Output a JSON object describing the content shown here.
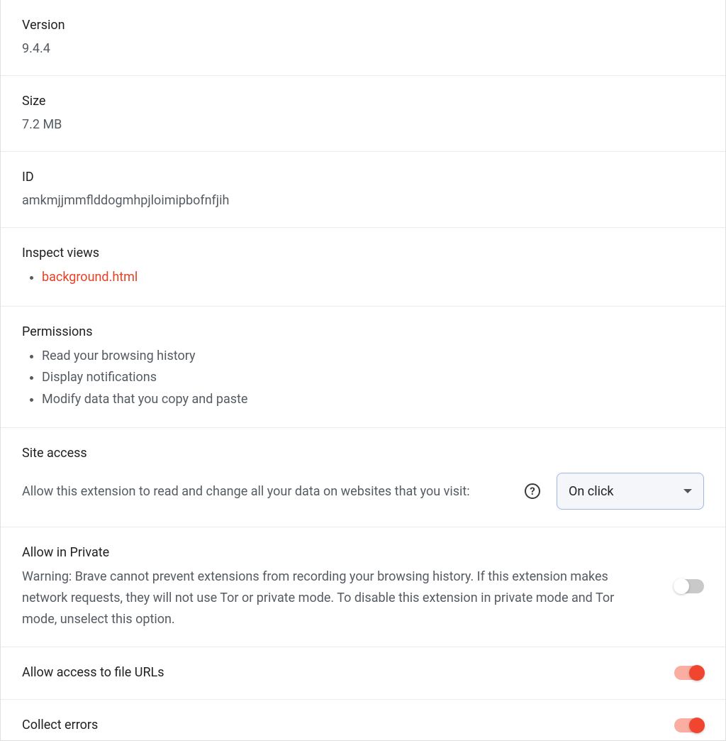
{
  "sections": {
    "version": {
      "label": "Version",
      "value": "9.4.4"
    },
    "size": {
      "label": "Size",
      "value": "7.2 MB"
    },
    "id": {
      "label": "ID",
      "value": "amkmjjmmflddogmhpjloimipbofnfjih"
    },
    "inspect": {
      "label": "Inspect views",
      "links": [
        "background.html"
      ]
    },
    "permissions": {
      "label": "Permissions",
      "items": [
        "Read your browsing history",
        "Display notifications",
        "Modify data that you copy and paste"
      ]
    },
    "site_access": {
      "label": "Site access",
      "desc": "Allow this extension to read and change all your data on websites that you visit:",
      "help": "?",
      "select_value": "On click"
    },
    "allow_private": {
      "label": "Allow in Private",
      "desc": "Warning: Brave cannot prevent extensions from recording your browsing history. If this extension makes network requests, they will not use Tor or private mode. To disable this extension in private mode and Tor mode, unselect this option.",
      "enabled": false
    },
    "file_urls": {
      "label": "Allow access to file URLs",
      "enabled": true
    },
    "collect_errors": {
      "label": "Collect errors",
      "enabled": true
    }
  }
}
